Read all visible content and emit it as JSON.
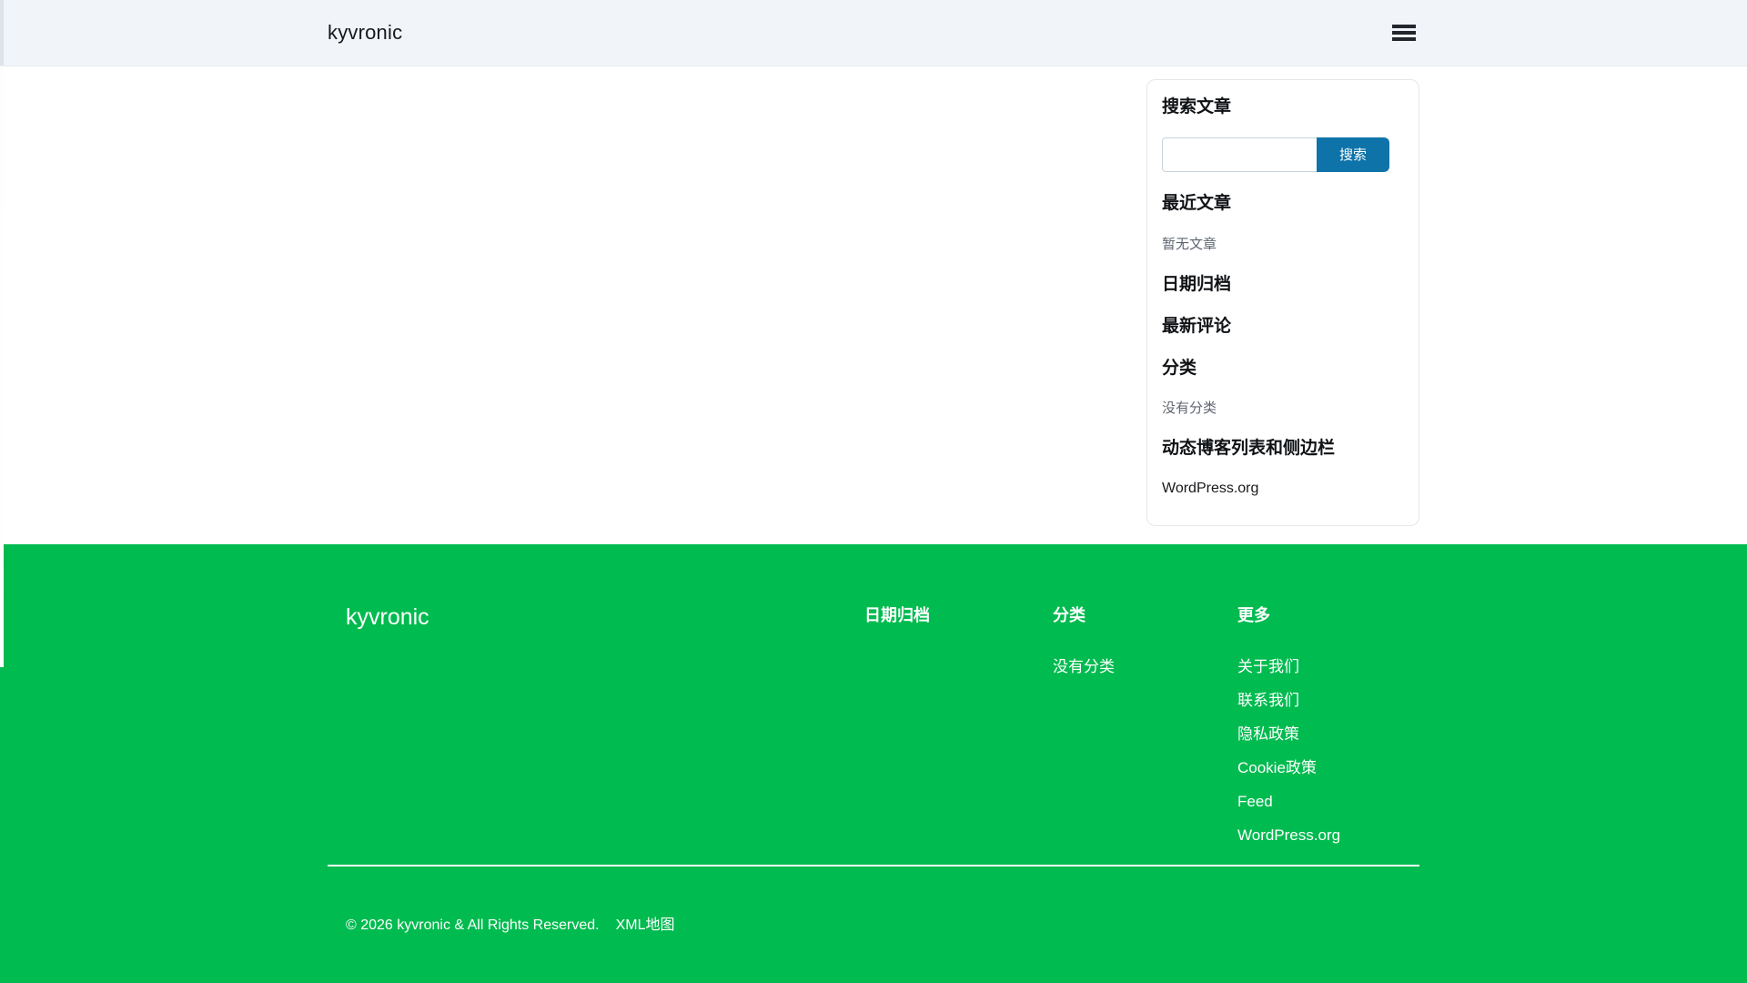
{
  "header": {
    "logo": "kyvronic"
  },
  "sidebar": {
    "search": {
      "title": "搜索文章",
      "input_value": "",
      "button_label": "搜索"
    },
    "recent_posts": {
      "title": "最近文章",
      "empty_text": "暂无文章"
    },
    "archives": {
      "title": "日期归档"
    },
    "recent_comments": {
      "title": "最新评论"
    },
    "categories": {
      "title": "分类",
      "empty_text": "没有分类"
    },
    "meta": {
      "title": "动态博客列表和侧边栏",
      "links": [
        {
          "label": "WordPress.org"
        }
      ]
    }
  },
  "footer": {
    "logo": "kyvronic",
    "archives": {
      "title": "日期归档"
    },
    "categories": {
      "title": "分类",
      "empty_text": "没有分类"
    },
    "more": {
      "title": "更多",
      "links": [
        "关于我们",
        "联系我们",
        "隐私政策",
        "Cookie政策",
        "Feed",
        "WordPress.org"
      ]
    },
    "copyright": "© 2026 kyvronic & All Rights Reserved.",
    "sitemap_label": "XML地图"
  },
  "colors": {
    "accent_green": "#00bb4f",
    "button_blue": "#0d73a8",
    "header_bg": "#f1f5f9"
  }
}
